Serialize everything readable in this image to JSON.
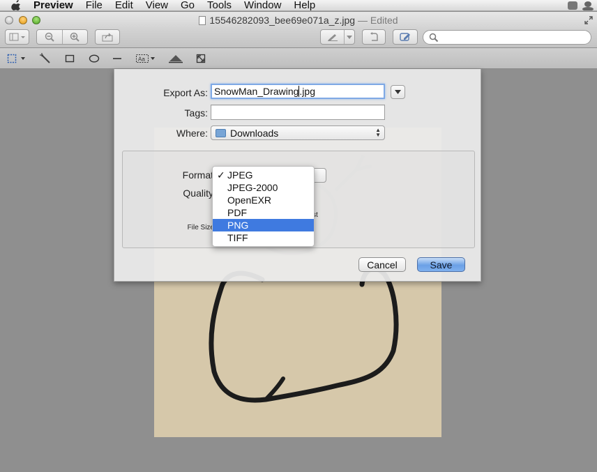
{
  "menubar": {
    "app_name": "Preview",
    "items": [
      "File",
      "Edit",
      "View",
      "Go",
      "Tools",
      "Window",
      "Help"
    ]
  },
  "window": {
    "title": "15546282093_bee69e071a_z.jpg",
    "edited": "— Edited"
  },
  "save_sheet": {
    "export_as_label": "Export As:",
    "export_as_value": "SnowMan_Drawing",
    "export_as_ext": ".jpg",
    "tags_label": "Tags:",
    "tags_value": "",
    "where_label": "Where:",
    "where_value": "Downloads",
    "format_label": "Format",
    "quality_label": "Quality",
    "quality_hint": "st",
    "file_size_label": "File Size",
    "cancel_label": "Cancel",
    "save_label": "Save"
  },
  "format_menu": {
    "options": [
      "JPEG",
      "JPEG-2000",
      "OpenEXR",
      "PDF",
      "PNG",
      "TIFF"
    ],
    "checked": "JPEG",
    "highlighted": "PNG"
  },
  "colors": {
    "accent": "#3f7ae0",
    "save_button": "#6ba0e6",
    "paper": "#d6c8aa"
  }
}
